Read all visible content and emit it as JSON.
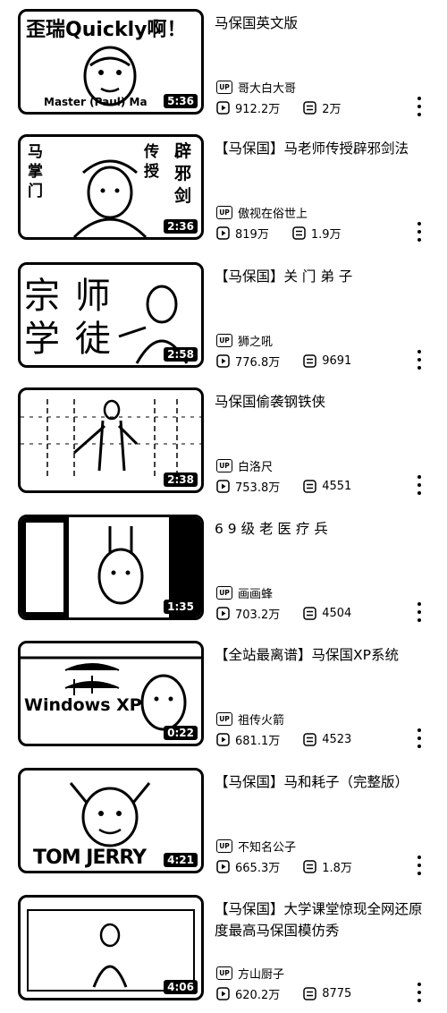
{
  "videos": [
    {
      "title": "马保国英文版",
      "uploader": "哥大白大哥",
      "views": "912.2万",
      "comments": "2万",
      "duration": "5:36",
      "thumb_caption_top": "歪瑞Quickly啊！",
      "thumb_caption_bottom": "Master (Paul) Ma"
    },
    {
      "title": "【马保国】马老师传授辟邪剑法",
      "uploader": "傲视在俗世上",
      "views": "819万",
      "comments": "1.9万",
      "duration": "2:36",
      "thumb_caption_left": "马掌门",
      "thumb_caption_mid": "传授",
      "thumb_caption_right": "辟邪剑"
    },
    {
      "title": "【马保国】关 门 弟 子",
      "uploader": "狮之吼",
      "views": "776.8万",
      "comments": "9691",
      "duration": "2:58",
      "thumb_caption_top": "宗 师",
      "thumb_caption_bottom": "学 徒"
    },
    {
      "title": "马保国偷袭钢铁侠",
      "uploader": "白洛尺",
      "views": "753.8万",
      "comments": "4551",
      "duration": "2:38"
    },
    {
      "title": "6 9 级 老 医 疗 兵",
      "uploader": "画画蜂",
      "views": "703.2万",
      "comments": "4504",
      "duration": "1:35"
    },
    {
      "title": "【全站最离谱】马保国XP系统",
      "uploader": "祖传火箭",
      "views": "681.1万",
      "comments": "4523",
      "duration": "0:22",
      "thumb_caption_bottom": "Windows XP"
    },
    {
      "title": "【马保国】马和耗子（完整版）",
      "uploader": "不知名公子",
      "views": "665.3万",
      "comments": "1.8万",
      "duration": "4:21",
      "thumb_caption_bottom": "TOM JERRY"
    },
    {
      "title": "【马保国】大学课堂惊现全网还原度最高马保国模仿秀",
      "uploader": "方山厨子",
      "views": "620.2万",
      "comments": "8775",
      "duration": "4:06"
    }
  ],
  "icons": {
    "uploader": "up-badge-icon",
    "views": "play-count-icon",
    "comments": "danmaku-icon",
    "more": "more-vertical-icon"
  },
  "badge_text": "UP"
}
